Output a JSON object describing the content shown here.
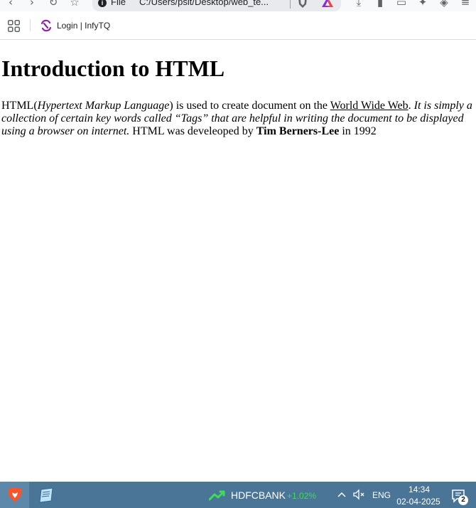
{
  "browser": {
    "url_scheme_label": "File",
    "url_path": "C:/Users/psit/Desktop/web_te...",
    "bookmarks": [
      {
        "label": "Login | InfyTQ",
        "icon": "infytq-logo-icon"
      }
    ]
  },
  "page": {
    "heading": "Introduction to HTML",
    "paragraph": {
      "t1": "HTML(",
      "t2_italic": "Hypertext Markup Language",
      "t3": ") is used to create document on the ",
      "link_text": "World Wide Web",
      "t4": ". ",
      "t5_italic": "It is simply a collection of certain key words called “Tags” that are helpful in writing the document to be displayed using a browser on internet.",
      "t6": " HTML was develeoped by ",
      "t7_bold": "Tim Berners-Lee",
      "t8": " in 1992"
    }
  },
  "taskbar": {
    "stock_name": "HDFCBANK",
    "stock_change": "+1.02%",
    "language": "ENG",
    "time": "14:34",
    "date": "02-04-2025",
    "notification_count": "2",
    "colors": {
      "taskbar_bg": "#4b7597",
      "stock_up": "#3ddc5a"
    }
  }
}
